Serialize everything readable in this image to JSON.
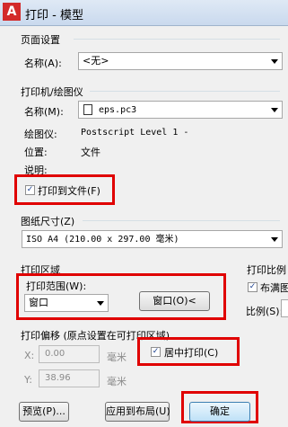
{
  "window": {
    "title": "打印 - 模型",
    "icon_letter": "A"
  },
  "page_setup": {
    "group_label": "页面设置",
    "name_label": "名称(A):",
    "name_value": "<无>"
  },
  "printer": {
    "group_label": "打印机/绘图仪",
    "name_label": "名称(M):",
    "name_value": "eps.pc3",
    "plotter_label": "绘图仪:",
    "plotter_value": "Postscript Level 1 -",
    "location_label": "位置:",
    "location_value": "文件",
    "description_label": "说明:",
    "print_to_file_label": "打印到文件(F)",
    "print_to_file_checked": true
  },
  "paper_size": {
    "group_label": "图纸尺寸(Z)",
    "value": "ISO A4 (210.00 x 297.00 毫米)"
  },
  "plot_area": {
    "group_label": "打印区域",
    "range_label": "打印范围(W):",
    "range_value": "窗口",
    "window_button": "窗口(O)<"
  },
  "plot_offset": {
    "group_label": "打印偏移 (原点设置在可打印区域)",
    "x_label": "X:",
    "x_value": "0.00",
    "x_unit": "毫米",
    "y_label": "Y:",
    "y_value": "38.96",
    "y_unit": "毫米",
    "center_label": "居中打印(C)",
    "center_checked": true
  },
  "plot_scale": {
    "group_label": "打印比例",
    "fit_label": "布满图",
    "fit_checked": true,
    "scale_label": "比例(S):"
  },
  "buttons": {
    "preview": "预览(P)...",
    "apply_layout": "应用到布局(U)",
    "ok": "确定"
  },
  "colors": {
    "highlight": "#e00000",
    "checkmark": "#1a3f8f"
  }
}
